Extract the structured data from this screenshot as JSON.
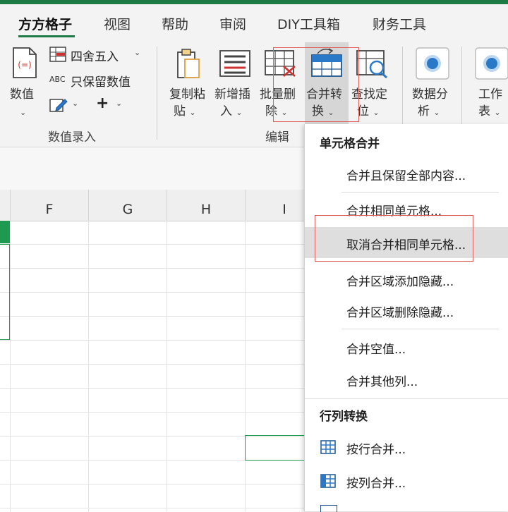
{
  "tabs": [
    "方方格子",
    "视图",
    "帮助",
    "审阅",
    "DIY工具箱",
    "财务工具"
  ],
  "ribbon": {
    "numeric": {
      "big_label": "数值",
      "round": "四舍五入",
      "keep_numeric": "只保留数值",
      "plus": "+"
    },
    "numeric_group": "数值录入",
    "edit_group": "编辑",
    "copy_paste": {
      "line1": "复制粘",
      "line2": "贴"
    },
    "new_insert": {
      "line1": "新增插",
      "line2": "入"
    },
    "batch_delete": {
      "line1": "批量删",
      "line2": "除"
    },
    "merge_convert": {
      "line1": "合并转",
      "line2": "换"
    },
    "find_locate": {
      "line1": "查找定",
      "line2": "位"
    },
    "data_analysis": {
      "line1": "数据分",
      "line2": "析"
    },
    "worksheet": {
      "line1": "工作",
      "line2": "表"
    },
    "icon_formula": "(=)",
    "icon_abc": "ABC"
  },
  "columns": [
    "F",
    "G",
    "H",
    "I"
  ],
  "menu": {
    "section1": "单元格合并",
    "items1": [
      "合并且保留全部内容...",
      "合并相同单元格...",
      "取消合并相同单元格...",
      "合并区域添加隐藏...",
      "合并区域删除隐藏...",
      "合并空值...",
      "合并其他列..."
    ],
    "section2": "行列转换",
    "items2": [
      "按行合并...",
      "按列合并..."
    ]
  },
  "colors": {
    "accent": "#1e7a45",
    "highlight_box": "#e06060",
    "menu_highlight": "#dedede",
    "icon_blue": "#2a78c8"
  }
}
